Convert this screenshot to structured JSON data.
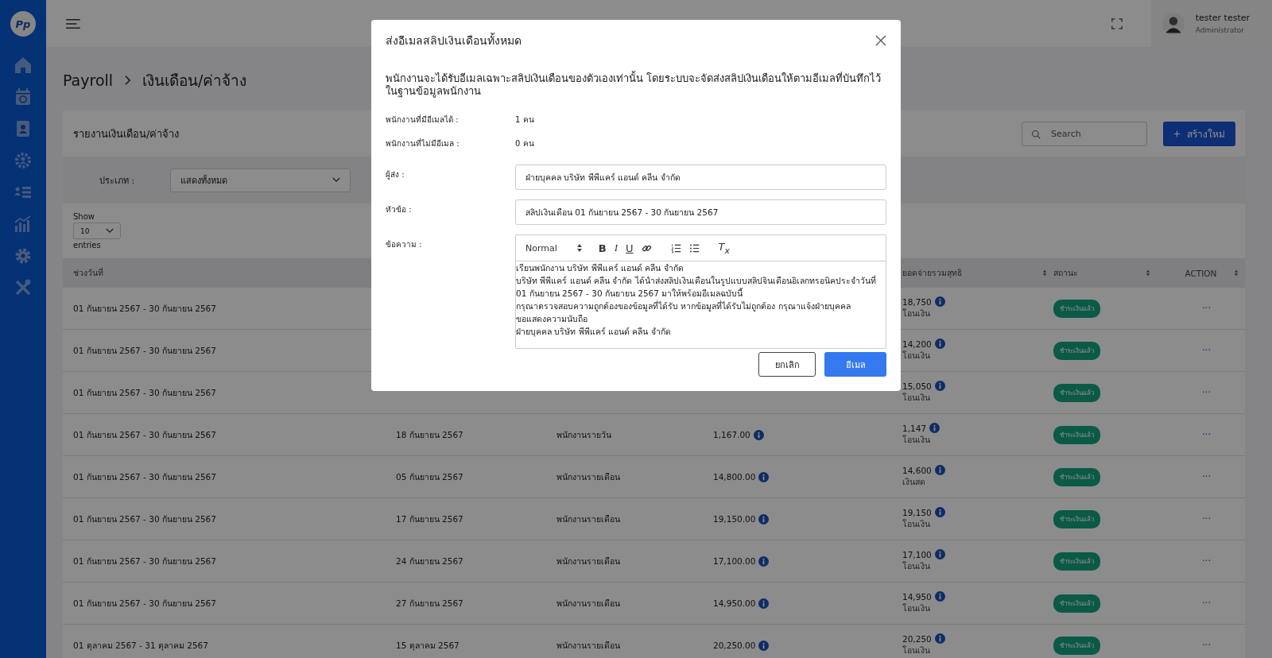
{
  "sidebar": {
    "logo_text": "Pp",
    "items": [
      {
        "kind": "home"
      },
      {
        "kind": "payroll"
      },
      {
        "kind": "contacts"
      },
      {
        "kind": "team"
      },
      {
        "kind": "list"
      },
      {
        "kind": "chart"
      },
      {
        "kind": "settings"
      },
      {
        "kind": "tools"
      }
    ]
  },
  "topbar": {
    "user": {
      "name": "tester tester",
      "role": "Administrator"
    }
  },
  "breadcrumb": [
    "Payroll",
    "เงินเดือน/ค่าจ้าง"
  ],
  "card": {
    "title": "รายงานเงินเดือน/ค่าจ้าง",
    "search": {
      "placeholder": "Search"
    },
    "create_button": "สร้างใหม่",
    "filter": {
      "label": "ประเภท :",
      "value": "แสดงทั้งหมด"
    },
    "show_entries": {
      "before": "Show",
      "value": "10",
      "after": "entries"
    }
  },
  "table": {
    "columns": [
      {
        "kind": "period",
        "label": "ช่วงวันที่"
      },
      {
        "kind": "net_pay",
        "label": "ยอดจ่ายรวมสุทธิ"
      },
      {
        "kind": "status",
        "label": "สถานะ"
      },
      {
        "kind": "action",
        "label": "ACTION"
      }
    ],
    "rows": [
      {
        "period": "01 กันยายน 2567 - 30 กันยายน 2567",
        "net_pay": "18,750",
        "method": "โอนเงิน",
        "status": "ชำระเงินแล้ว",
        "action": "···"
      },
      {
        "period": "01 กันยายน 2567 - 30 กันยายน 2567",
        "net_pay": "14,200",
        "method": "โอนเงิน",
        "status": "ชำระเงินแล้ว",
        "action": "···"
      },
      {
        "period": "01 กันยายน 2567 - 30 กันยายน 2567",
        "net_pay": "15,050",
        "method": "โอนเงิน",
        "status": "ชำระเงินแล้ว",
        "action": "···"
      },
      {
        "period": "01 กันยายน 2567 - 30 กันยายน 2567",
        "pay_date": "18 กันยายน 2567",
        "employee_type": "พนักงานรายวัน",
        "amount": "1,167.00",
        "net_pay": "1,147",
        "method": "โอนเงิน",
        "status": "ชำระเงินแล้ว",
        "action": "···"
      },
      {
        "period": "01 กันยายน 2567 - 30 กันยายน 2567",
        "pay_date": "05 กันยายน 2567",
        "employee_type": "พนักงานรายเดือน",
        "amount": "14,800.00",
        "net_pay": "14,600",
        "method": "เงินสด",
        "status": "ชำระเงินแล้ว",
        "action": "···"
      },
      {
        "period": "01 กันยายน 2567 - 30 กันยายน 2567",
        "pay_date": "17 กันยายน 2567",
        "employee_type": "พนักงานรายเดือน",
        "amount": "19,150.00",
        "net_pay": "19,150",
        "method": "โอนเงิน",
        "status": "ชำระเงินแล้ว",
        "action": "···"
      },
      {
        "period": "01 กันยายน 2567 - 30 กันยายน 2567",
        "pay_date": "24 กันยายน 2567",
        "employee_type": "พนักงานรายเดือน",
        "amount": "17,100.00",
        "net_pay": "17,100",
        "method": "โอนเงิน",
        "status": "ชำระเงินแล้ว",
        "action": "···"
      },
      {
        "period": "01 กันยายน 2567 - 30 กันยายน 2567",
        "pay_date": "27 กันยายน 2567",
        "employee_type": "พนักงานรายเดือน",
        "amount": "14,950.00",
        "net_pay": "14,950",
        "method": "โอนเงิน",
        "status": "ชำระเงินแล้ว",
        "action": "···"
      },
      {
        "period": "01 ตุลาคม 2567 - 31 ตุลาคม 2567",
        "pay_date": "15 ตุลาคม 2567",
        "employee_type": "พนักงานรายเดือน",
        "amount": "20,250.00",
        "net_pay": "20,250",
        "method": "โอนเงิน",
        "status": "ชำระเงินแล้ว",
        "action": "···"
      }
    ]
  },
  "modal": {
    "title": "ส่งอีเมลสลิปเงินเดือนทั้งหมด",
    "intro": "พนักงานจะได้รับอีเมลเฉพาะสลิปเงินเดือนของตัวเองเท่านั้น โดยระบบจะจัดส่งสลิปเงินเดือนให้ตามอีเมลที่บันทึกไว้ในฐานข้อมูลพนักงาน",
    "stats": [
      {
        "label": "พนักงานที่มีอีเมลได้ :",
        "value": "1 คน"
      },
      {
        "label": "พนักงานที่ไม่มีอีเมล :",
        "value": "0 คน"
      }
    ],
    "fields": [
      {
        "kind": "input",
        "label": "ผู้ส่ง :",
        "value": "ฝ่ายบุคคล บริษัท พีพีแคร์ แอนด์ คลีน จำกัด"
      },
      {
        "kind": "input",
        "label": "หัวข้อ :",
        "value": "สลิปเงินเดือน 01 กันยายน 2567 - 30 กันยายน 2567"
      },
      {
        "kind": "editor",
        "label": "ข้อความ :",
        "toolbar": [
          {
            "kind": "header",
            "label": "Normal"
          },
          {
            "kind": "bold",
            "label": "B"
          },
          {
            "kind": "italic",
            "label": "I"
          },
          {
            "kind": "underline",
            "label": "U"
          },
          {
            "kind": "link"
          },
          {
            "kind": "ordered-list"
          },
          {
            "kind": "bullet-list"
          },
          {
            "kind": "clean",
            "label": "T$_{x}$"
          }
        ],
        "lines": [
          "เรียนพนักงาน บริษัท พีพีแคร์ แอนด์ คลีน จำกัด",
          "บริษัท พีพีแคร์ แอนด์ คลีน จำกัด ได้นำส่งสลิปเงินเดือนในรูปแบบสลิปจินเดือนอิเลกทรอนิคประจำวันที่ 01 กันยายน 2567 - 30 กันยายน 2567 มาให้พร้อมอีเมลฉบับนี้",
          "กรุณาตรวจสอบความถูกต้องของข้อมูลที่ได้รับ หากข้อมูลที่ได้รับไม่ถูกต้อง กรุณาแจ้งฝ่ายบุคคล",
          "ขอแสดงความนับถือ",
          "ฝ่ายบุคคล บริษัท พีพีแคร์ แอนด์ คลีน จำกัด"
        ]
      }
    ],
    "buttons": [
      {
        "kind": "secondary",
        "label": "ยกเลิก"
      },
      {
        "kind": "primary",
        "label": "อีเมล"
      }
    ]
  }
}
